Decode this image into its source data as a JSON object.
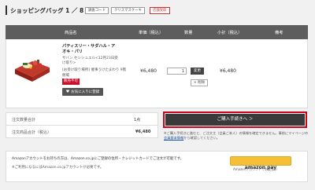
{
  "page": {
    "title": "ショッピングバッグ 1 ／ 8",
    "tags": [
      "調査コード",
      "クリスマスケーキ",
      "店舗受取"
    ]
  },
  "table": {
    "headers": [
      "商品名",
      "単価（税込）",
      "数量",
      "小計（税込）",
      "備考"
    ],
    "item": {
      "name": "パティスリー・サダハル・アオキ・パリ",
      "sub_line1": "サバン セシシュエル<12月23日受け取り>",
      "sub_line2": "[お受け取り場所] 催事うけたまわり 9階",
      "sub_line3": "催場",
      "badge": "販売不可",
      "favorite_label": "お気に入りに登録",
      "unit_price": "¥6,480",
      "quantity": "1",
      "change_label": "変更",
      "delete_label": "× 削除",
      "subtotal": "¥6,480"
    }
  },
  "summary": {
    "qty_label": "注文数量合計",
    "qty_value": "1点",
    "total_label": "注文商品合計（税込）",
    "total_value": "¥6,480"
  },
  "checkout": {
    "button_label": "ご購入手続きへ ＞",
    "note_prefix": "※ご購入手続きに進むと、ご注文主（会員ご本人）の情報を確定できません。事前にマイページの",
    "note_link": "会員基本情報",
    "note_suffix": "から確認してください。"
  },
  "amazon": {
    "line1": "Amazonアカウントをお持ちの方は、Amazon.co.jpにご登録の住所・クレジットカードでご注文が可能です。",
    "line2": "※ご利用になるにはAmazon.co.jpアカウントが必要です。",
    "button_label": "amazon pay",
    "button_caption": "Amazonアカウントでお支払い"
  },
  "colors": {
    "header_bg": "#5d5d5d",
    "dark_button": "#3a3a3a",
    "highlight": "#d0021b",
    "badge_red": "#c8102e",
    "amazon_yellow": "#f5c035"
  }
}
